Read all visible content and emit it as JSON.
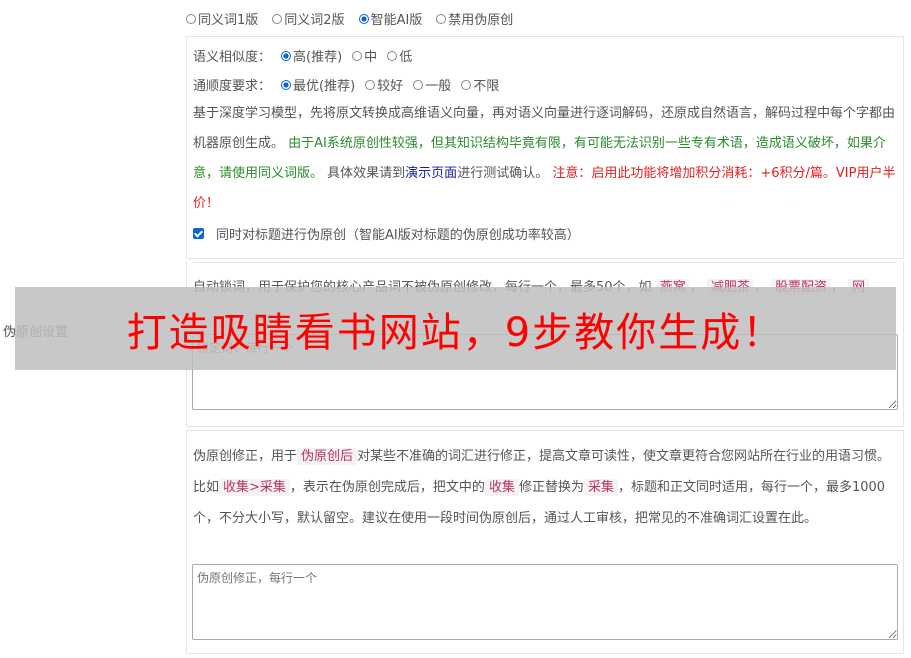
{
  "modes": [
    {
      "label": "同义词1版",
      "selected": false
    },
    {
      "label": "同义词2版",
      "selected": false
    },
    {
      "label": "智能AI版",
      "selected": true
    },
    {
      "label": "禁用伪原创",
      "selected": false
    }
  ],
  "side_label": "伪原创设置",
  "similarity": {
    "label": "语义相似度：",
    "options": [
      {
        "label": "高(推荐)",
        "selected": true
      },
      {
        "label": "中",
        "selected": false
      },
      {
        "label": "低",
        "selected": false
      }
    ]
  },
  "fluency": {
    "label": "通顺度要求：",
    "options": [
      {
        "label": "最优(推荐)",
        "selected": true
      },
      {
        "label": "较好",
        "selected": false
      },
      {
        "label": "一般",
        "selected": false
      },
      {
        "label": "不限",
        "selected": false
      }
    ]
  },
  "description": {
    "part1": "基于深度学习模型，先将原文转换成高维语义向量，再对语义向量进行逐词解码，还原成自然语言，解码过程中每个字都由机器原创生成。",
    "part2_green": "由于AI系统原创性较强，但其知识结构毕竟有限，有可能无法识别一些专有术语，造成语义破坏，如果介意，请使用同义词版。",
    "part3": "具体效果请到",
    "link": "演示页面",
    "part4": "进行测试确认。",
    "part5_red": "注意：启用此功能将增加积分消耗：+6积分/篇。VIP用户半价！"
  },
  "title_checkbox": {
    "label": "同时对标题进行伪原创（智能AI版对标题的伪原创成功率较高）",
    "checked": true
  },
  "lock": {
    "text": "自动锁词，用于保护您的核心产品词不被伪原创修改，每行一个，最多50个，如",
    "examples": [
      "燕窝",
      "减肥茶",
      "股票配资",
      "网"
    ],
    "placeholder": "锁定词，每行一个"
  },
  "correction": {
    "text1": "伪原创修正，用于",
    "tag1": "伪原创后",
    "text2": "对某些不准确的词汇进行修正，提高文章可读性，使文章更符合您网站所在行业的用语习惯。比如",
    "tag2": "收集>采集",
    "text3": "，表示在伪原创完成后，把文中的",
    "tag3": "收集",
    "text4": "修正替换为",
    "tag4": "采集",
    "text5": "，标题和正文同时适用，每行一个，最多1000个，不分大小写，默认留空。建议在使用一段时间伪原创后，通过人工审核，把常见的不准确词汇设置在此。",
    "placeholder": "伪原创修正，每行一个"
  },
  "banner": "打造吸睛看书网站，9步教你生成！"
}
